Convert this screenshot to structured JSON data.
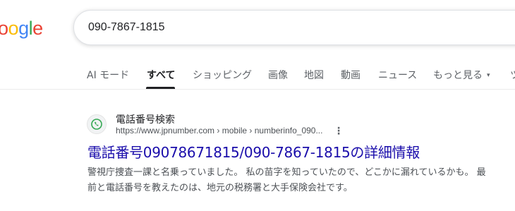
{
  "logo": {
    "letters": [
      "o",
      "o",
      "g",
      "l",
      "e"
    ]
  },
  "search": {
    "value": "090-7867-1815"
  },
  "tabs": [
    {
      "label": "AI モード"
    },
    {
      "label": "すべて"
    },
    {
      "label": "ショッピング"
    },
    {
      "label": "画像"
    },
    {
      "label": "地図"
    },
    {
      "label": "動画"
    },
    {
      "label": "ニュース"
    },
    {
      "label": "もっと見る"
    }
  ],
  "tabs_more_chevron": "▾",
  "tabs_overflow": "ツ",
  "result": {
    "site_name": "電話番号検索",
    "url": "https://www.jpnumber.com › mobile › numberinfo_090...",
    "menu_glyph": "⋮",
    "title": "電話番号09078671815/090-7867-1815の詳細情報",
    "snippet_line1": "警視庁捜査一課と名乗っていました。 私の苗字を知っていたので、どこかに漏れているかも。 最",
    "snippet_line2": "前と電話番号を教えたのは、地元の税務署と大手保険会社です。"
  },
  "colors": {
    "link": "#1a0dab",
    "text": "#202124",
    "muted": "#4d5156"
  },
  "icons": {
    "favicon": "phone-icon",
    "menu": "more-vert-icon"
  }
}
